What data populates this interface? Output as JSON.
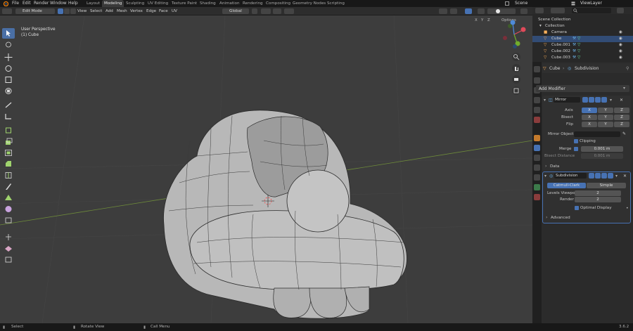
{
  "topbar": {
    "menus": [
      "File",
      "Edit",
      "Render",
      "Window",
      "Help"
    ],
    "workspaces": [
      "Layout",
      "Modeling",
      "Sculpting",
      "UV Editing",
      "Texture Paint",
      "Shading",
      "Animation",
      "Rendering",
      "Compositing",
      "Geometry Nodes",
      "Scripting"
    ],
    "active_workspace": "Modeling",
    "scene": "Scene",
    "view_layer": "ViewLayer"
  },
  "viewport_header": {
    "mode": "Edit Mode",
    "menus": [
      "View",
      "Select",
      "Add",
      "Mesh",
      "Vertex",
      "Edge",
      "Face",
      "UV"
    ],
    "transform_orientation": "Global",
    "axes": [
      "X",
      "Y",
      "Z"
    ],
    "options": "Options"
  },
  "viewport": {
    "perspective_label": "User Perspective",
    "object_label": "(1) Cube"
  },
  "outliner": {
    "root": "Scene Collection",
    "collection": "Collection",
    "items": [
      "Camera",
      "Cube",
      "Cube.001",
      "Cube.002",
      "Cube.003"
    ],
    "selected": "Cube"
  },
  "properties": {
    "breadcrumb_object": "Cube",
    "breadcrumb_modifier": "Subdivision",
    "add_modifier": "Add Modifier",
    "mirror": {
      "name": "Mirror",
      "axis_label": "Axis",
      "bisect_label": "Bisect",
      "flip_label": "Flip",
      "mirror_object_label": "Mirror Object",
      "clipping_label": "Clipping",
      "merge_label": "Merge",
      "merge_value": "0.001 m",
      "bisect_distance_label": "Bisect Distance",
      "bisect_distance_value": "0.001 m",
      "data_label": "Data"
    },
    "subdivision": {
      "name": "Subdivision",
      "catmull_clark": "Catmull-Clark",
      "simple": "Simple",
      "levels_viewport_label": "Levels Viewport",
      "levels_viewport_value": "2",
      "render_label": "Render",
      "render_value": "2",
      "optimal_display_label": "Optimal Display",
      "advanced_label": "Advanced"
    }
  },
  "statusbar": {
    "select": "Select",
    "rotate": "Rotate View",
    "call_menu": "Call Menu",
    "version": "3.6.2"
  },
  "colors": {
    "accent": "#4772b3",
    "selection": "#324c75",
    "viewport_bg": "#3d3d3d",
    "mesh": "#b9b9b9"
  }
}
